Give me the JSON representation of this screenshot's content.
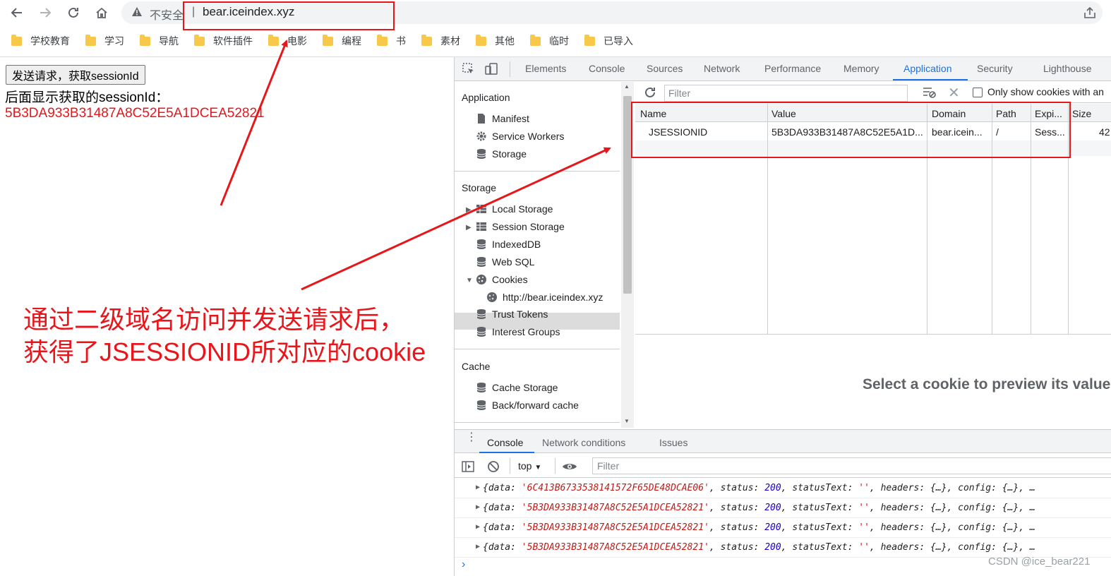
{
  "browser": {
    "omnibox": {
      "insecure_label": "不安全",
      "separator": "|",
      "url": "bear.iceindex.xyz"
    },
    "bookmarks": [
      "学校教育",
      "学习",
      "导航",
      "软件插件",
      "电影",
      "编程",
      "书",
      "素材",
      "其他",
      "临时",
      "已导入"
    ]
  },
  "page": {
    "button_label": "发送请求，获取sessionId",
    "label": "后面显示获取的sessionId：",
    "session_id": "5B3DA933B31487A8C52E5A1DCEA52821"
  },
  "annotation": {
    "line1": "通过二级域名访问并发送请求后，",
    "line2": "获得了JSESSIONID所对应的cookie"
  },
  "devtools": {
    "tabs": [
      "Elements",
      "Console",
      "Sources",
      "Network",
      "Performance",
      "Memory",
      "Application",
      "Security",
      "Lighthouse"
    ],
    "active_tab": "Application",
    "sidebar": {
      "application_header": "Application",
      "application_items": [
        "Manifest",
        "Service Workers",
        "Storage"
      ],
      "storage_header": "Storage",
      "storage_items": [
        "Local Storage",
        "Session Storage",
        "IndexedDB",
        "Web SQL",
        "Cookies"
      ],
      "cookie_origin": "http://bear.iceindex.xyz",
      "storage_items_2": [
        "Trust Tokens",
        "Interest Groups"
      ],
      "cache_header": "Cache",
      "cache_items": [
        "Cache Storage",
        "Back/forward cache"
      ]
    },
    "filter_bar": {
      "placeholder": "Filter",
      "only_show_label": "Only show cookies with an"
    },
    "table": {
      "columns": [
        "Name",
        "Value",
        "Domain",
        "Path",
        "Expi...",
        "Size"
      ],
      "rows": [
        {
          "name": "JSESSIONID",
          "value": "5B3DA933B31487A8C52E5A1D...",
          "domain": "bear.icein...",
          "path": "/",
          "expires": "Sess...",
          "size": "42"
        }
      ]
    },
    "preview_text": "Select a cookie to preview its value",
    "drawer": {
      "tabs": [
        "Console",
        "Network conditions",
        "Issues"
      ],
      "active_tab": "Console",
      "context": "top",
      "filter_placeholder": "Filter",
      "logs": [
        {
          "data": "'6C413B6733538141572F65DE48DCAE06'",
          "status": "200",
          "statusText": "''"
        },
        {
          "data": "'5B3DA933B31487A8C52E5A1DCEA52821'",
          "status": "200",
          "statusText": "''"
        },
        {
          "data": "'5B3DA933B31487A8C52E5A1DCEA52821'",
          "status": "200",
          "statusText": "''"
        },
        {
          "data": "'5B3DA933B31487A8C52E5A1DCEA52821'",
          "status": "200",
          "statusText": "''"
        }
      ],
      "log_keys": {
        "data": "data:",
        "status": "status:",
        "statusText": "statusText:",
        "headers": "headers:",
        "config": "config:",
        "ellipsis": "{…}",
        "more": "…"
      }
    }
  },
  "watermark": "CSDN @ice_bear221",
  "colors": {
    "annotation_red": "#e8161b",
    "devtools_blue": "#1a73e8"
  }
}
